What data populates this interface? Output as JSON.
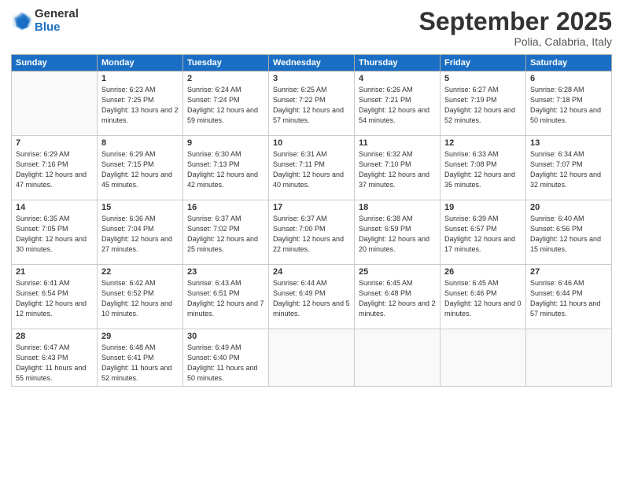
{
  "header": {
    "logo_general": "General",
    "logo_blue": "Blue",
    "month": "September 2025",
    "location": "Polia, Calabria, Italy"
  },
  "weekdays": [
    "Sunday",
    "Monday",
    "Tuesday",
    "Wednesday",
    "Thursday",
    "Friday",
    "Saturday"
  ],
  "weeks": [
    [
      {
        "day": "",
        "info": ""
      },
      {
        "day": "1",
        "info": "Sunrise: 6:23 AM\nSunset: 7:25 PM\nDaylight: 13 hours\nand 2 minutes."
      },
      {
        "day": "2",
        "info": "Sunrise: 6:24 AM\nSunset: 7:24 PM\nDaylight: 12 hours\nand 59 minutes."
      },
      {
        "day": "3",
        "info": "Sunrise: 6:25 AM\nSunset: 7:22 PM\nDaylight: 12 hours\nand 57 minutes."
      },
      {
        "day": "4",
        "info": "Sunrise: 6:26 AM\nSunset: 7:21 PM\nDaylight: 12 hours\nand 54 minutes."
      },
      {
        "day": "5",
        "info": "Sunrise: 6:27 AM\nSunset: 7:19 PM\nDaylight: 12 hours\nand 52 minutes."
      },
      {
        "day": "6",
        "info": "Sunrise: 6:28 AM\nSunset: 7:18 PM\nDaylight: 12 hours\nand 50 minutes."
      }
    ],
    [
      {
        "day": "7",
        "info": "Sunrise: 6:29 AM\nSunset: 7:16 PM\nDaylight: 12 hours\nand 47 minutes."
      },
      {
        "day": "8",
        "info": "Sunrise: 6:29 AM\nSunset: 7:15 PM\nDaylight: 12 hours\nand 45 minutes."
      },
      {
        "day": "9",
        "info": "Sunrise: 6:30 AM\nSunset: 7:13 PM\nDaylight: 12 hours\nand 42 minutes."
      },
      {
        "day": "10",
        "info": "Sunrise: 6:31 AM\nSunset: 7:11 PM\nDaylight: 12 hours\nand 40 minutes."
      },
      {
        "day": "11",
        "info": "Sunrise: 6:32 AM\nSunset: 7:10 PM\nDaylight: 12 hours\nand 37 minutes."
      },
      {
        "day": "12",
        "info": "Sunrise: 6:33 AM\nSunset: 7:08 PM\nDaylight: 12 hours\nand 35 minutes."
      },
      {
        "day": "13",
        "info": "Sunrise: 6:34 AM\nSunset: 7:07 PM\nDaylight: 12 hours\nand 32 minutes."
      }
    ],
    [
      {
        "day": "14",
        "info": "Sunrise: 6:35 AM\nSunset: 7:05 PM\nDaylight: 12 hours\nand 30 minutes."
      },
      {
        "day": "15",
        "info": "Sunrise: 6:36 AM\nSunset: 7:04 PM\nDaylight: 12 hours\nand 27 minutes."
      },
      {
        "day": "16",
        "info": "Sunrise: 6:37 AM\nSunset: 7:02 PM\nDaylight: 12 hours\nand 25 minutes."
      },
      {
        "day": "17",
        "info": "Sunrise: 6:37 AM\nSunset: 7:00 PM\nDaylight: 12 hours\nand 22 minutes."
      },
      {
        "day": "18",
        "info": "Sunrise: 6:38 AM\nSunset: 6:59 PM\nDaylight: 12 hours\nand 20 minutes."
      },
      {
        "day": "19",
        "info": "Sunrise: 6:39 AM\nSunset: 6:57 PM\nDaylight: 12 hours\nand 17 minutes."
      },
      {
        "day": "20",
        "info": "Sunrise: 6:40 AM\nSunset: 6:56 PM\nDaylight: 12 hours\nand 15 minutes."
      }
    ],
    [
      {
        "day": "21",
        "info": "Sunrise: 6:41 AM\nSunset: 6:54 PM\nDaylight: 12 hours\nand 12 minutes."
      },
      {
        "day": "22",
        "info": "Sunrise: 6:42 AM\nSunset: 6:52 PM\nDaylight: 12 hours\nand 10 minutes."
      },
      {
        "day": "23",
        "info": "Sunrise: 6:43 AM\nSunset: 6:51 PM\nDaylight: 12 hours\nand 7 minutes."
      },
      {
        "day": "24",
        "info": "Sunrise: 6:44 AM\nSunset: 6:49 PM\nDaylight: 12 hours\nand 5 minutes."
      },
      {
        "day": "25",
        "info": "Sunrise: 6:45 AM\nSunset: 6:48 PM\nDaylight: 12 hours\nand 2 minutes."
      },
      {
        "day": "26",
        "info": "Sunrise: 6:45 AM\nSunset: 6:46 PM\nDaylight: 12 hours\nand 0 minutes."
      },
      {
        "day": "27",
        "info": "Sunrise: 6:46 AM\nSunset: 6:44 PM\nDaylight: 11 hours\nand 57 minutes."
      }
    ],
    [
      {
        "day": "28",
        "info": "Sunrise: 6:47 AM\nSunset: 6:43 PM\nDaylight: 11 hours\nand 55 minutes."
      },
      {
        "day": "29",
        "info": "Sunrise: 6:48 AM\nSunset: 6:41 PM\nDaylight: 11 hours\nand 52 minutes."
      },
      {
        "day": "30",
        "info": "Sunrise: 6:49 AM\nSunset: 6:40 PM\nDaylight: 11 hours\nand 50 minutes."
      },
      {
        "day": "",
        "info": ""
      },
      {
        "day": "",
        "info": ""
      },
      {
        "day": "",
        "info": ""
      },
      {
        "day": "",
        "info": ""
      }
    ]
  ]
}
